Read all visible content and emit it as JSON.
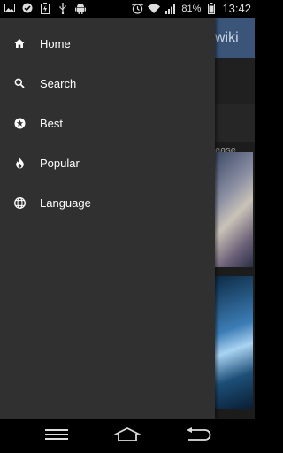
{
  "status_bar": {
    "battery_percent": "81%",
    "time": "13:42",
    "icons": [
      "gallery-icon",
      "check-circle-icon",
      "battery-charging-icon",
      "usb-icon",
      "android-icon",
      "alarm-icon",
      "wifi-icon",
      "signal-icon",
      "battery-icon"
    ]
  },
  "background_app": {
    "toolbar_title_partial": "wiki",
    "caption_partial": "ease"
  },
  "drawer": {
    "items": [
      {
        "label": "Home",
        "icon": "home-icon"
      },
      {
        "label": "Search",
        "icon": "search-icon"
      },
      {
        "label": "Best",
        "icon": "star-icon"
      },
      {
        "label": "Popular",
        "icon": "flame-icon"
      },
      {
        "label": "Language",
        "icon": "globe-icon"
      }
    ]
  },
  "nav_bar": {
    "buttons": [
      "menu-icon",
      "home-icon",
      "back-icon"
    ]
  },
  "colors": {
    "drawer_bg": "#303030",
    "toolbar_bg": "#3a5577",
    "text": "#ffffff"
  }
}
